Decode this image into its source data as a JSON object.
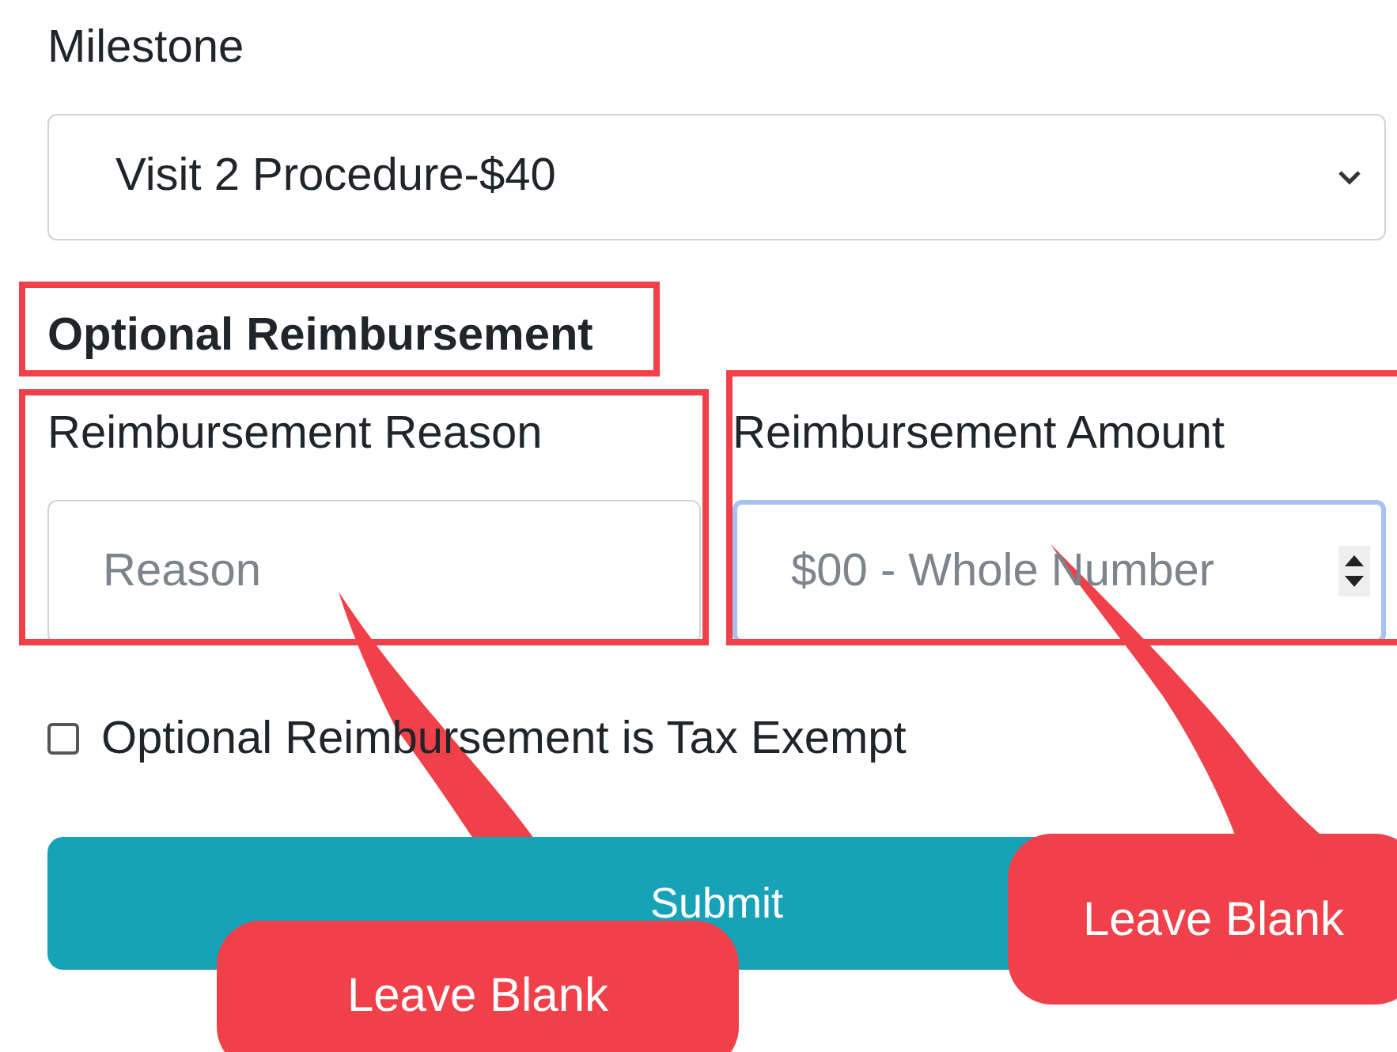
{
  "milestone": {
    "label": "Milestone",
    "value": "Visit 2 Procedure-$40"
  },
  "section": {
    "title": "Optional Reimbursement",
    "highlighted": true
  },
  "fields": [
    {
      "label": "Reimbursement Reason",
      "placeholder": "Reason",
      "highlighted": true,
      "focused": false,
      "kind": "text"
    },
    {
      "label": "Reimbursement Amount",
      "placeholder": "$00 - Whole Number",
      "highlighted": true,
      "focused": true,
      "kind": "number"
    }
  ],
  "tax_exempt": {
    "label": "Optional Reimbursement is Tax Exempt",
    "checked": false
  },
  "submit": {
    "label": "Submit"
  },
  "callouts": [
    {
      "text": "Leave Blank"
    },
    {
      "text": "Leave Blank"
    }
  ]
}
